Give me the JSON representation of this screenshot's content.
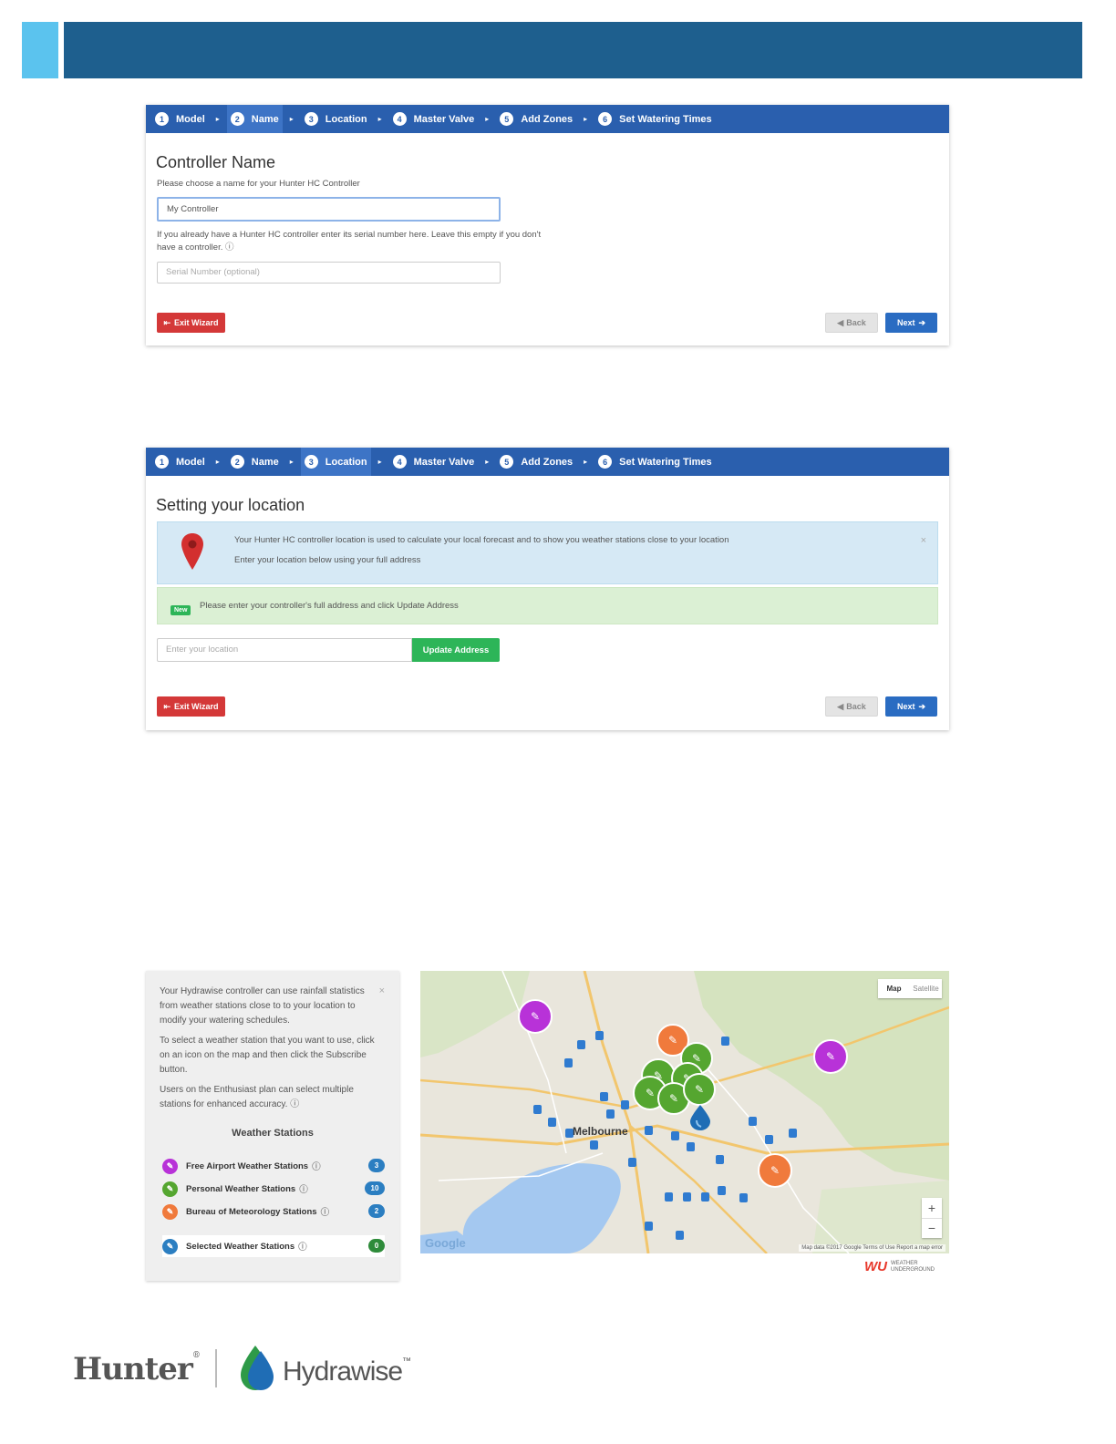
{
  "steps": [
    {
      "num": "1",
      "label": "Model"
    },
    {
      "num": "2",
      "label": "Name"
    },
    {
      "num": "3",
      "label": "Location"
    },
    {
      "num": "4",
      "label": "Master Valve"
    },
    {
      "num": "5",
      "label": "Add Zones"
    },
    {
      "num": "6",
      "label": "Set Watering Times"
    }
  ],
  "name_panel": {
    "title": "Controller Name",
    "prompt": "Please choose a name for your Hunter HC Controller",
    "name_value": "My Controller",
    "serial_help": "If you already have a Hunter HC controller enter its serial number here. Leave this empty if you don't have a controller.",
    "serial_placeholder": "Serial Number (optional)"
  },
  "location_panel": {
    "title": "Setting your location",
    "info_line1": "Your Hunter HC controller location is used to calculate your local forecast and to show you weather stations close to your location",
    "info_line2": "Enter your location below using your full address",
    "badge": "New",
    "success_text": "Please enter your controller's full address and click Update Address",
    "location_placeholder": "Enter your location",
    "update_button": "Update Address"
  },
  "buttons": {
    "exit": "Exit Wizard",
    "back": "Back",
    "next": "Next"
  },
  "weather_panel": {
    "para1": "Your Hydrawise controller can use rainfall statistics from weather stations close to to your location to modify your watering schedules.",
    "para2": "To select a weather station that you want to use, click on an icon on the map and then click the Subscribe button.",
    "para3": "Users on the Enthusiast plan can select multiple stations for enhanced accuracy.",
    "heading": "Weather Stations",
    "legend": [
      {
        "label": "Free Airport Weather Stations",
        "count": "3",
        "color": "#b832d8"
      },
      {
        "label": "Personal Weather Stations",
        "count": "10",
        "color": "#55a630"
      },
      {
        "label": "Bureau of Meteorology Stations",
        "count": "2",
        "color": "#f07a3c"
      },
      {
        "label": "Selected Weather Stations",
        "count": "0",
        "color": "#2b7ec1"
      }
    ]
  },
  "map": {
    "type_map": "Map",
    "type_satellite": "Satellite",
    "city": "Melbourne",
    "zoom_in": "+",
    "zoom_out": "−",
    "google": "Google",
    "attribution": "Map data ©2017 Google   Terms of Use   Report a map error",
    "wu_mark": "WU",
    "wu_text": "WEATHER UNDERGROUND"
  },
  "footer": {
    "brand1": "Hunter",
    "brand2": "Hydrawise",
    "tm": "™"
  }
}
